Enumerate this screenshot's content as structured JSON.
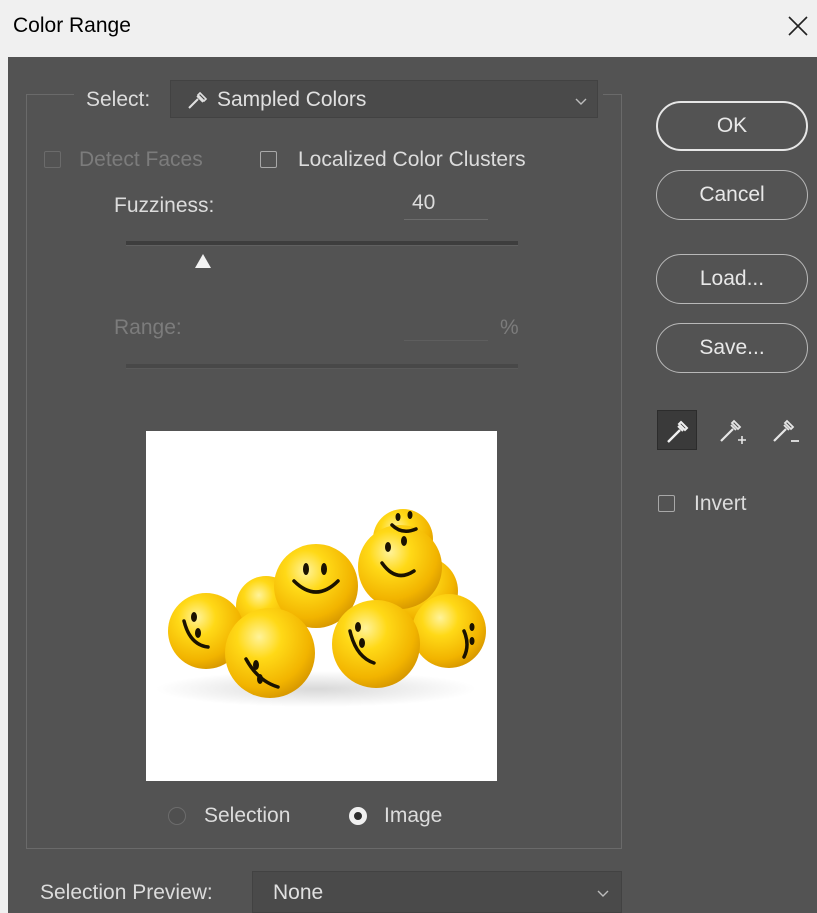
{
  "window": {
    "title": "Color Range"
  },
  "select": {
    "label": "Select:",
    "value": "Sampled Colors"
  },
  "options": {
    "detect_faces": {
      "label": "Detect Faces",
      "checked": false,
      "enabled": false
    },
    "localized_clusters": {
      "label": "Localized Color Clusters",
      "checked": false
    }
  },
  "fuzziness": {
    "label": "Fuzziness:",
    "value": "40",
    "slider_fraction": 0.195
  },
  "range": {
    "label": "Range:",
    "value": "",
    "unit": "%"
  },
  "view": {
    "selection_label": "Selection",
    "image_label": "Image",
    "selected": "image"
  },
  "buttons": {
    "ok": "OK",
    "cancel": "Cancel",
    "load": "Load...",
    "save": "Save..."
  },
  "tools": [
    "eyedropper-icon",
    "eyedropper-plus-icon",
    "eyedropper-minus-icon"
  ],
  "invert": {
    "label": "Invert",
    "checked": false
  },
  "selection_preview": {
    "label": "Selection Preview:",
    "value": "None"
  }
}
